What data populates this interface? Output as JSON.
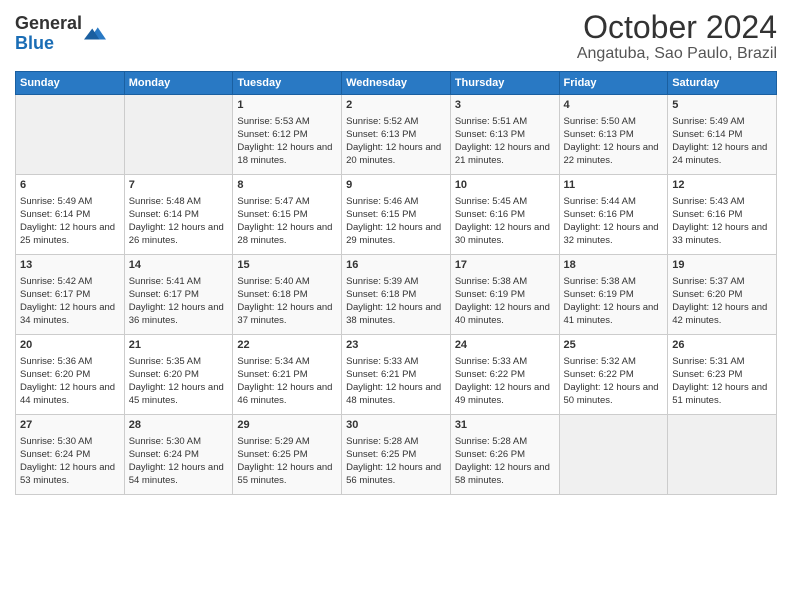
{
  "header": {
    "logo_line1": "General",
    "logo_line2": "Blue",
    "title": "October 2024",
    "subtitle": "Angatuba, Sao Paulo, Brazil"
  },
  "weekdays": [
    "Sunday",
    "Monday",
    "Tuesday",
    "Wednesday",
    "Thursday",
    "Friday",
    "Saturday"
  ],
  "weeks": [
    [
      {
        "day": "",
        "content": ""
      },
      {
        "day": "",
        "content": ""
      },
      {
        "day": "1",
        "content": "Sunrise: 5:53 AM\nSunset: 6:12 PM\nDaylight: 12 hours and 18 minutes."
      },
      {
        "day": "2",
        "content": "Sunrise: 5:52 AM\nSunset: 6:13 PM\nDaylight: 12 hours and 20 minutes."
      },
      {
        "day": "3",
        "content": "Sunrise: 5:51 AM\nSunset: 6:13 PM\nDaylight: 12 hours and 21 minutes."
      },
      {
        "day": "4",
        "content": "Sunrise: 5:50 AM\nSunset: 6:13 PM\nDaylight: 12 hours and 22 minutes."
      },
      {
        "day": "5",
        "content": "Sunrise: 5:49 AM\nSunset: 6:14 PM\nDaylight: 12 hours and 24 minutes."
      }
    ],
    [
      {
        "day": "6",
        "content": "Sunrise: 5:49 AM\nSunset: 6:14 PM\nDaylight: 12 hours and 25 minutes."
      },
      {
        "day": "7",
        "content": "Sunrise: 5:48 AM\nSunset: 6:14 PM\nDaylight: 12 hours and 26 minutes."
      },
      {
        "day": "8",
        "content": "Sunrise: 5:47 AM\nSunset: 6:15 PM\nDaylight: 12 hours and 28 minutes."
      },
      {
        "day": "9",
        "content": "Sunrise: 5:46 AM\nSunset: 6:15 PM\nDaylight: 12 hours and 29 minutes."
      },
      {
        "day": "10",
        "content": "Sunrise: 5:45 AM\nSunset: 6:16 PM\nDaylight: 12 hours and 30 minutes."
      },
      {
        "day": "11",
        "content": "Sunrise: 5:44 AM\nSunset: 6:16 PM\nDaylight: 12 hours and 32 minutes."
      },
      {
        "day": "12",
        "content": "Sunrise: 5:43 AM\nSunset: 6:16 PM\nDaylight: 12 hours and 33 minutes."
      }
    ],
    [
      {
        "day": "13",
        "content": "Sunrise: 5:42 AM\nSunset: 6:17 PM\nDaylight: 12 hours and 34 minutes."
      },
      {
        "day": "14",
        "content": "Sunrise: 5:41 AM\nSunset: 6:17 PM\nDaylight: 12 hours and 36 minutes."
      },
      {
        "day": "15",
        "content": "Sunrise: 5:40 AM\nSunset: 6:18 PM\nDaylight: 12 hours and 37 minutes."
      },
      {
        "day": "16",
        "content": "Sunrise: 5:39 AM\nSunset: 6:18 PM\nDaylight: 12 hours and 38 minutes."
      },
      {
        "day": "17",
        "content": "Sunrise: 5:38 AM\nSunset: 6:19 PM\nDaylight: 12 hours and 40 minutes."
      },
      {
        "day": "18",
        "content": "Sunrise: 5:38 AM\nSunset: 6:19 PM\nDaylight: 12 hours and 41 minutes."
      },
      {
        "day": "19",
        "content": "Sunrise: 5:37 AM\nSunset: 6:20 PM\nDaylight: 12 hours and 42 minutes."
      }
    ],
    [
      {
        "day": "20",
        "content": "Sunrise: 5:36 AM\nSunset: 6:20 PM\nDaylight: 12 hours and 44 minutes."
      },
      {
        "day": "21",
        "content": "Sunrise: 5:35 AM\nSunset: 6:20 PM\nDaylight: 12 hours and 45 minutes."
      },
      {
        "day": "22",
        "content": "Sunrise: 5:34 AM\nSunset: 6:21 PM\nDaylight: 12 hours and 46 minutes."
      },
      {
        "day": "23",
        "content": "Sunrise: 5:33 AM\nSunset: 6:21 PM\nDaylight: 12 hours and 48 minutes."
      },
      {
        "day": "24",
        "content": "Sunrise: 5:33 AM\nSunset: 6:22 PM\nDaylight: 12 hours and 49 minutes."
      },
      {
        "day": "25",
        "content": "Sunrise: 5:32 AM\nSunset: 6:22 PM\nDaylight: 12 hours and 50 minutes."
      },
      {
        "day": "26",
        "content": "Sunrise: 5:31 AM\nSunset: 6:23 PM\nDaylight: 12 hours and 51 minutes."
      }
    ],
    [
      {
        "day": "27",
        "content": "Sunrise: 5:30 AM\nSunset: 6:24 PM\nDaylight: 12 hours and 53 minutes."
      },
      {
        "day": "28",
        "content": "Sunrise: 5:30 AM\nSunset: 6:24 PM\nDaylight: 12 hours and 54 minutes."
      },
      {
        "day": "29",
        "content": "Sunrise: 5:29 AM\nSunset: 6:25 PM\nDaylight: 12 hours and 55 minutes."
      },
      {
        "day": "30",
        "content": "Sunrise: 5:28 AM\nSunset: 6:25 PM\nDaylight: 12 hours and 56 minutes."
      },
      {
        "day": "31",
        "content": "Sunrise: 5:28 AM\nSunset: 6:26 PM\nDaylight: 12 hours and 58 minutes."
      },
      {
        "day": "",
        "content": ""
      },
      {
        "day": "",
        "content": ""
      }
    ]
  ]
}
